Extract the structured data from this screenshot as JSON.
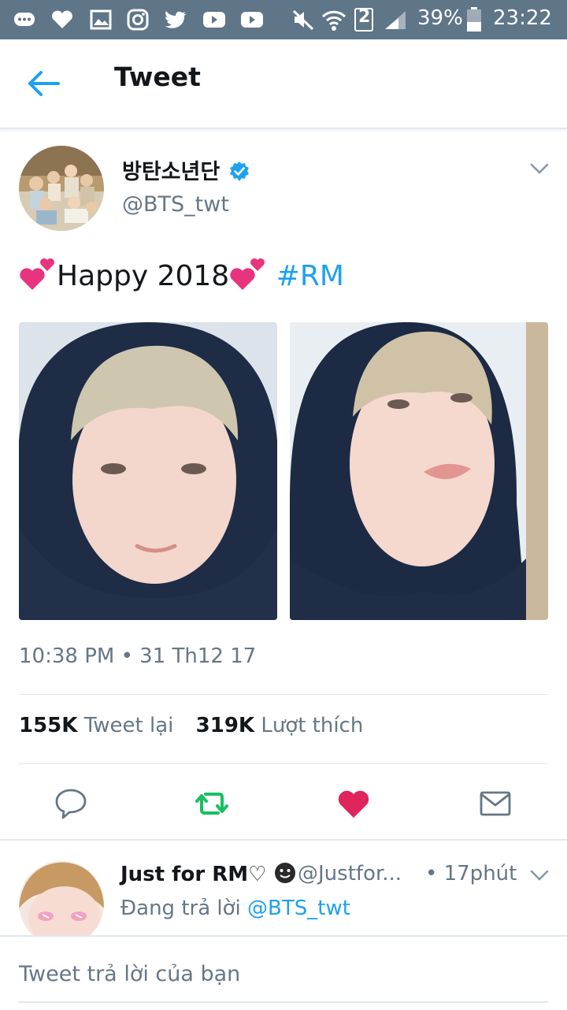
{
  "status_bar": {
    "battery": "39%",
    "time": "23:22",
    "sim": "2"
  },
  "header": {
    "title": "Tweet"
  },
  "tweet": {
    "display_name": "방탄소년단",
    "handle": "@BTS_twt",
    "text": "Happy 2018",
    "hashtag": "#RM",
    "timestamp": "10:38 PM • 31 Th12 17",
    "retweet_count": "155K",
    "retweet_label": "Tweet lại",
    "like_count": "319K",
    "like_label": "Lượt thích"
  },
  "reply": {
    "display_name": "Just for RM♡",
    "handle": "@Justfor...",
    "time": "• 17phút",
    "replying_to_label": "Đang trả lời",
    "replying_to_handle": "@BTS_twt"
  },
  "compose": {
    "placeholder": "Tweet trả lời của bạn"
  },
  "colors": {
    "accent": "#1da1f2",
    "retweet": "#17bf63",
    "like": "#e0245e",
    "status_bar": "#5f7588"
  }
}
